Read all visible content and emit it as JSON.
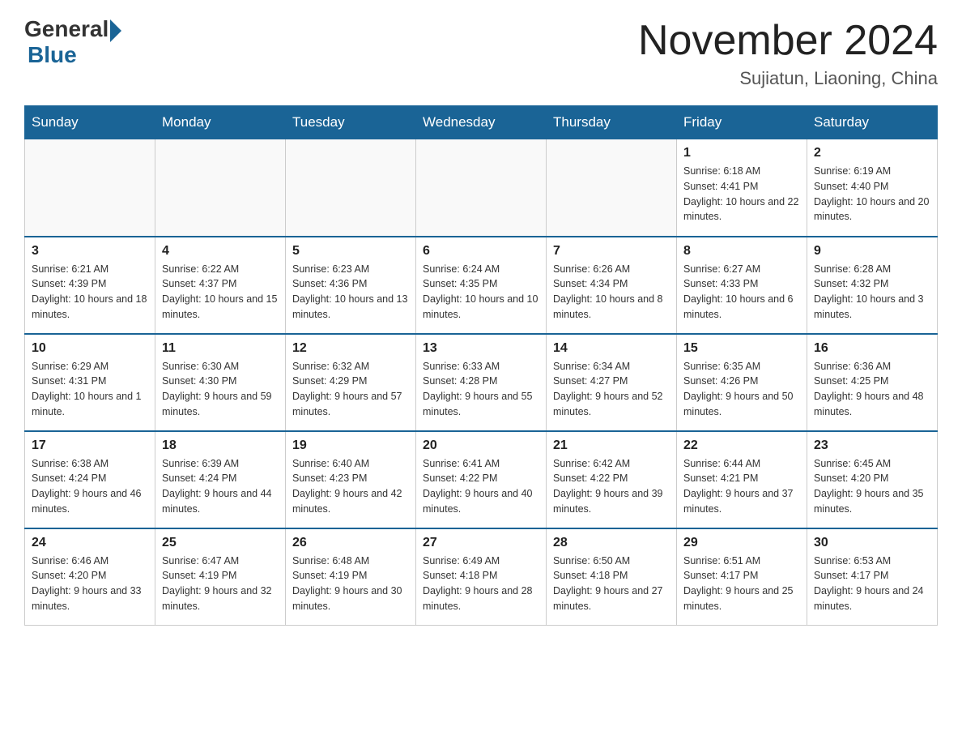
{
  "header": {
    "logo_general": "General",
    "logo_blue": "Blue",
    "month_title": "November 2024",
    "location": "Sujiatun, Liaoning, China"
  },
  "days_of_week": [
    "Sunday",
    "Monday",
    "Tuesday",
    "Wednesday",
    "Thursday",
    "Friday",
    "Saturday"
  ],
  "weeks": [
    [
      {
        "day": "",
        "sunrise": "",
        "sunset": "",
        "daylight": ""
      },
      {
        "day": "",
        "sunrise": "",
        "sunset": "",
        "daylight": ""
      },
      {
        "day": "",
        "sunrise": "",
        "sunset": "",
        "daylight": ""
      },
      {
        "day": "",
        "sunrise": "",
        "sunset": "",
        "daylight": ""
      },
      {
        "day": "",
        "sunrise": "",
        "sunset": "",
        "daylight": ""
      },
      {
        "day": "1",
        "sunrise": "Sunrise: 6:18 AM",
        "sunset": "Sunset: 4:41 PM",
        "daylight": "Daylight: 10 hours and 22 minutes."
      },
      {
        "day": "2",
        "sunrise": "Sunrise: 6:19 AM",
        "sunset": "Sunset: 4:40 PM",
        "daylight": "Daylight: 10 hours and 20 minutes."
      }
    ],
    [
      {
        "day": "3",
        "sunrise": "Sunrise: 6:21 AM",
        "sunset": "Sunset: 4:39 PM",
        "daylight": "Daylight: 10 hours and 18 minutes."
      },
      {
        "day": "4",
        "sunrise": "Sunrise: 6:22 AM",
        "sunset": "Sunset: 4:37 PM",
        "daylight": "Daylight: 10 hours and 15 minutes."
      },
      {
        "day": "5",
        "sunrise": "Sunrise: 6:23 AM",
        "sunset": "Sunset: 4:36 PM",
        "daylight": "Daylight: 10 hours and 13 minutes."
      },
      {
        "day": "6",
        "sunrise": "Sunrise: 6:24 AM",
        "sunset": "Sunset: 4:35 PM",
        "daylight": "Daylight: 10 hours and 10 minutes."
      },
      {
        "day": "7",
        "sunrise": "Sunrise: 6:26 AM",
        "sunset": "Sunset: 4:34 PM",
        "daylight": "Daylight: 10 hours and 8 minutes."
      },
      {
        "day": "8",
        "sunrise": "Sunrise: 6:27 AM",
        "sunset": "Sunset: 4:33 PM",
        "daylight": "Daylight: 10 hours and 6 minutes."
      },
      {
        "day": "9",
        "sunrise": "Sunrise: 6:28 AM",
        "sunset": "Sunset: 4:32 PM",
        "daylight": "Daylight: 10 hours and 3 minutes."
      }
    ],
    [
      {
        "day": "10",
        "sunrise": "Sunrise: 6:29 AM",
        "sunset": "Sunset: 4:31 PM",
        "daylight": "Daylight: 10 hours and 1 minute."
      },
      {
        "day": "11",
        "sunrise": "Sunrise: 6:30 AM",
        "sunset": "Sunset: 4:30 PM",
        "daylight": "Daylight: 9 hours and 59 minutes."
      },
      {
        "day": "12",
        "sunrise": "Sunrise: 6:32 AM",
        "sunset": "Sunset: 4:29 PM",
        "daylight": "Daylight: 9 hours and 57 minutes."
      },
      {
        "day": "13",
        "sunrise": "Sunrise: 6:33 AM",
        "sunset": "Sunset: 4:28 PM",
        "daylight": "Daylight: 9 hours and 55 minutes."
      },
      {
        "day": "14",
        "sunrise": "Sunrise: 6:34 AM",
        "sunset": "Sunset: 4:27 PM",
        "daylight": "Daylight: 9 hours and 52 minutes."
      },
      {
        "day": "15",
        "sunrise": "Sunrise: 6:35 AM",
        "sunset": "Sunset: 4:26 PM",
        "daylight": "Daylight: 9 hours and 50 minutes."
      },
      {
        "day": "16",
        "sunrise": "Sunrise: 6:36 AM",
        "sunset": "Sunset: 4:25 PM",
        "daylight": "Daylight: 9 hours and 48 minutes."
      }
    ],
    [
      {
        "day": "17",
        "sunrise": "Sunrise: 6:38 AM",
        "sunset": "Sunset: 4:24 PM",
        "daylight": "Daylight: 9 hours and 46 minutes."
      },
      {
        "day": "18",
        "sunrise": "Sunrise: 6:39 AM",
        "sunset": "Sunset: 4:24 PM",
        "daylight": "Daylight: 9 hours and 44 minutes."
      },
      {
        "day": "19",
        "sunrise": "Sunrise: 6:40 AM",
        "sunset": "Sunset: 4:23 PM",
        "daylight": "Daylight: 9 hours and 42 minutes."
      },
      {
        "day": "20",
        "sunrise": "Sunrise: 6:41 AM",
        "sunset": "Sunset: 4:22 PM",
        "daylight": "Daylight: 9 hours and 40 minutes."
      },
      {
        "day": "21",
        "sunrise": "Sunrise: 6:42 AM",
        "sunset": "Sunset: 4:22 PM",
        "daylight": "Daylight: 9 hours and 39 minutes."
      },
      {
        "day": "22",
        "sunrise": "Sunrise: 6:44 AM",
        "sunset": "Sunset: 4:21 PM",
        "daylight": "Daylight: 9 hours and 37 minutes."
      },
      {
        "day": "23",
        "sunrise": "Sunrise: 6:45 AM",
        "sunset": "Sunset: 4:20 PM",
        "daylight": "Daylight: 9 hours and 35 minutes."
      }
    ],
    [
      {
        "day": "24",
        "sunrise": "Sunrise: 6:46 AM",
        "sunset": "Sunset: 4:20 PM",
        "daylight": "Daylight: 9 hours and 33 minutes."
      },
      {
        "day": "25",
        "sunrise": "Sunrise: 6:47 AM",
        "sunset": "Sunset: 4:19 PM",
        "daylight": "Daylight: 9 hours and 32 minutes."
      },
      {
        "day": "26",
        "sunrise": "Sunrise: 6:48 AM",
        "sunset": "Sunset: 4:19 PM",
        "daylight": "Daylight: 9 hours and 30 minutes."
      },
      {
        "day": "27",
        "sunrise": "Sunrise: 6:49 AM",
        "sunset": "Sunset: 4:18 PM",
        "daylight": "Daylight: 9 hours and 28 minutes."
      },
      {
        "day": "28",
        "sunrise": "Sunrise: 6:50 AM",
        "sunset": "Sunset: 4:18 PM",
        "daylight": "Daylight: 9 hours and 27 minutes."
      },
      {
        "day": "29",
        "sunrise": "Sunrise: 6:51 AM",
        "sunset": "Sunset: 4:17 PM",
        "daylight": "Daylight: 9 hours and 25 minutes."
      },
      {
        "day": "30",
        "sunrise": "Sunrise: 6:53 AM",
        "sunset": "Sunset: 4:17 PM",
        "daylight": "Daylight: 9 hours and 24 minutes."
      }
    ]
  ]
}
